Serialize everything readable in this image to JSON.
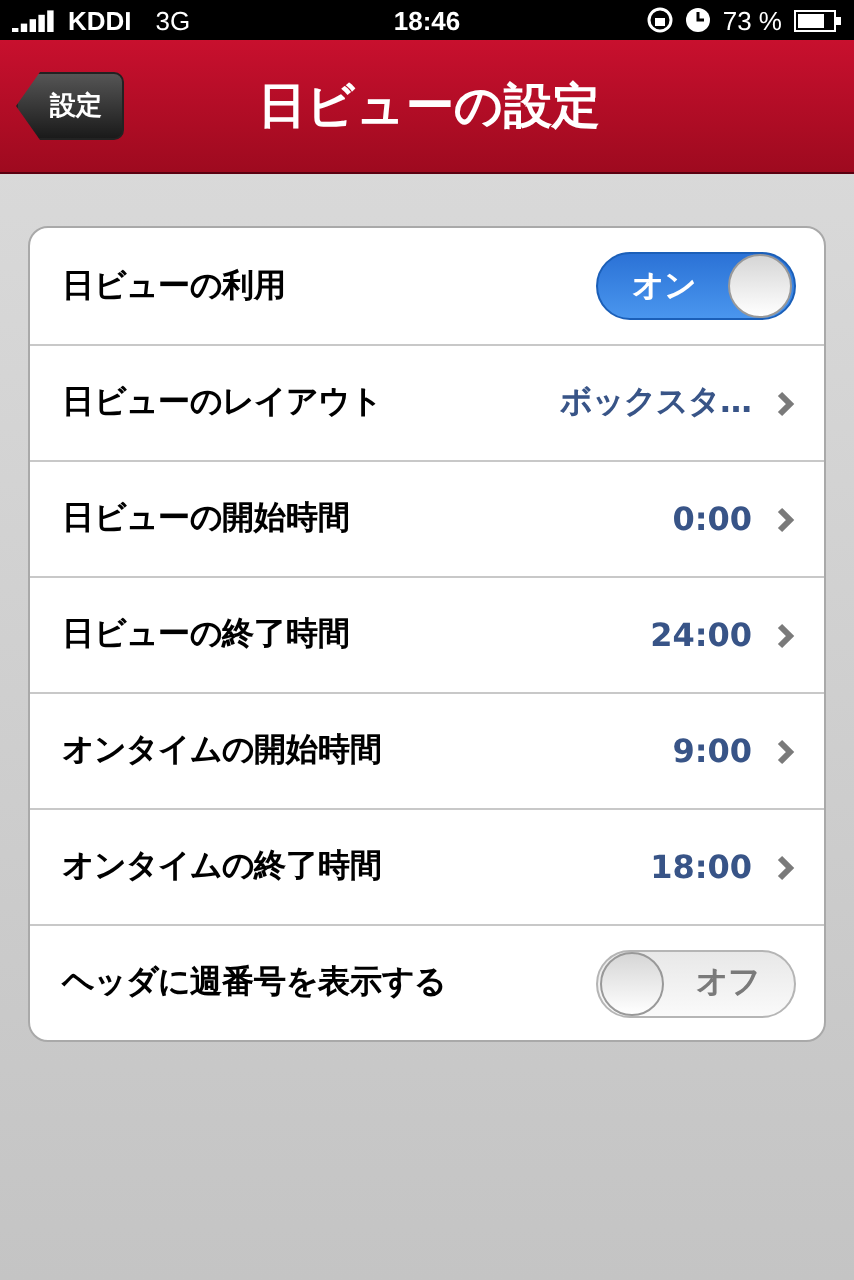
{
  "status_bar": {
    "carrier": "KDDI",
    "network": "3G",
    "time": "18:46",
    "battery": "73 %"
  },
  "nav_bar": {
    "back_button": "設定",
    "title": "日ビューの設定"
  },
  "rows": [
    {
      "kind": "switch",
      "label": "日ビューの利用",
      "on": true,
      "switch_text": "オン"
    },
    {
      "kind": "disclosure",
      "label": "日ビューのレイアウト",
      "value": "ボックスタ…"
    },
    {
      "kind": "disclosure",
      "label": "日ビューの開始時間",
      "value": "0:00"
    },
    {
      "kind": "disclosure",
      "label": "日ビューの終了時間",
      "value": "24:00"
    },
    {
      "kind": "disclosure",
      "label": "オンタイムの開始時間",
      "value": "9:00"
    },
    {
      "kind": "disclosure",
      "label": "オンタイムの終了時間",
      "value": "18:00"
    },
    {
      "kind": "switch",
      "label": "ヘッダに週番号を表示する",
      "on": false,
      "switch_text": "オフ"
    }
  ]
}
